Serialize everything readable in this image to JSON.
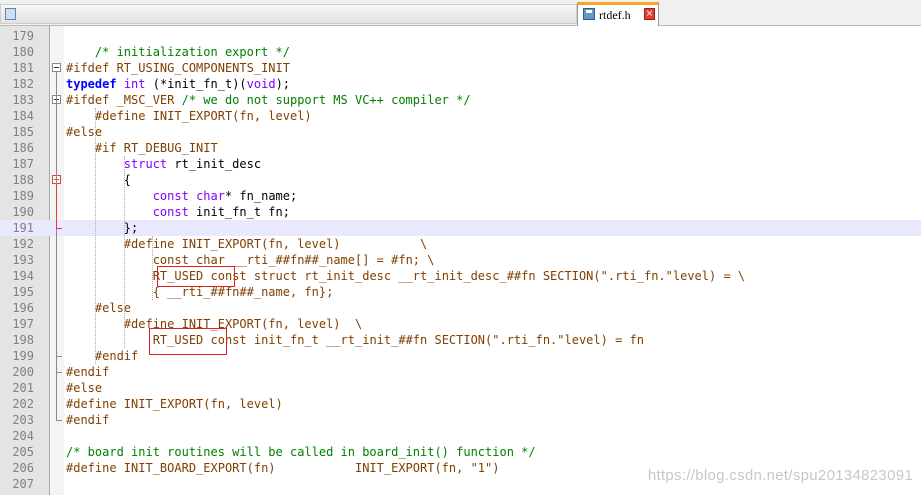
{
  "tab": {
    "filename": "rtdef.h",
    "close_glyph": "×",
    "accent_color": "#f5a623"
  },
  "lines": [
    {
      "num": "179",
      "tokens": []
    },
    {
      "num": "180",
      "tokens": [
        {
          "t": "    ",
          "c": ""
        },
        {
          "t": "/* initialization export */",
          "c": "cm"
        }
      ]
    },
    {
      "num": "181",
      "tokens": [
        {
          "t": "#ifdef RT_USING_COMPONENTS_INIT",
          "c": "pp"
        }
      ]
    },
    {
      "num": "182",
      "tokens": [
        {
          "t": "typedef",
          "c": "kw"
        },
        {
          "t": " ",
          "c": ""
        },
        {
          "t": "int",
          "c": "ty"
        },
        {
          "t": " (*init_fn_t)(",
          "c": ""
        },
        {
          "t": "void",
          "c": "ty"
        },
        {
          "t": ");",
          "c": ""
        }
      ]
    },
    {
      "num": "183",
      "tokens": [
        {
          "t": "#ifdef _MSC_VER ",
          "c": "pp"
        },
        {
          "t": "/* we do not support MS VC++ compiler */",
          "c": "cm"
        }
      ]
    },
    {
      "num": "184",
      "tokens": [
        {
          "t": "    ",
          "c": ""
        },
        {
          "t": "#define INIT_EXPORT(fn, level)",
          "c": "pp"
        }
      ]
    },
    {
      "num": "185",
      "tokens": [
        {
          "t": "#else",
          "c": "pp"
        }
      ]
    },
    {
      "num": "186",
      "tokens": [
        {
          "t": "    ",
          "c": ""
        },
        {
          "t": "#if RT_DEBUG_INIT",
          "c": "pp"
        }
      ]
    },
    {
      "num": "187",
      "tokens": [
        {
          "t": "        ",
          "c": ""
        },
        {
          "t": "struct",
          "c": "ty"
        },
        {
          "t": " rt_init_desc",
          "c": ""
        }
      ]
    },
    {
      "num": "188",
      "tokens": [
        {
          "t": "        {",
          "c": ""
        }
      ]
    },
    {
      "num": "189",
      "tokens": [
        {
          "t": "            ",
          "c": ""
        },
        {
          "t": "const",
          "c": "ty"
        },
        {
          "t": " ",
          "c": ""
        },
        {
          "t": "char",
          "c": "ty"
        },
        {
          "t": "* fn_name;",
          "c": ""
        }
      ]
    },
    {
      "num": "190",
      "tokens": [
        {
          "t": "            ",
          "c": ""
        },
        {
          "t": "const",
          "c": "ty"
        },
        {
          "t": " init_fn_t fn;",
          "c": ""
        }
      ]
    },
    {
      "num": "191",
      "tokens": [
        {
          "t": "        };",
          "c": ""
        }
      ]
    },
    {
      "num": "192",
      "tokens": [
        {
          "t": "        ",
          "c": ""
        },
        {
          "t": "#define INIT_EXPORT(fn, level)           \\",
          "c": "pp"
        }
      ]
    },
    {
      "num": "193",
      "tokens": [
        {
          "t": "            ",
          "c": ""
        },
        {
          "t": "const char __rti_##fn##_name[] = #fn; \\",
          "c": "pp"
        }
      ]
    },
    {
      "num": "194",
      "tokens": [
        {
          "t": "            ",
          "c": ""
        },
        {
          "t": "RT_USED const struct rt_init_desc __rt_init_desc_##fn SECTION(\".rti_fn.\"level) = \\",
          "c": "pp"
        }
      ]
    },
    {
      "num": "195",
      "tokens": [
        {
          "t": "            ",
          "c": ""
        },
        {
          "t": "{ __rti_##fn##_name, fn};",
          "c": "pp"
        }
      ]
    },
    {
      "num": "196",
      "tokens": [
        {
          "t": "    ",
          "c": ""
        },
        {
          "t": "#else",
          "c": "pp"
        }
      ]
    },
    {
      "num": "197",
      "tokens": [
        {
          "t": "        ",
          "c": ""
        },
        {
          "t": "#define INIT_EXPORT(fn, level)  \\",
          "c": "pp"
        }
      ]
    },
    {
      "num": "198",
      "tokens": [
        {
          "t": "            ",
          "c": ""
        },
        {
          "t": "RT_USED const init_fn_t __rt_init_##fn SECTION(\".rti_fn.\"level) = fn",
          "c": "pp"
        }
      ]
    },
    {
      "num": "199",
      "tokens": [
        {
          "t": "    ",
          "c": ""
        },
        {
          "t": "#endif",
          "c": "pp"
        }
      ]
    },
    {
      "num": "200",
      "tokens": [
        {
          "t": "#endif",
          "c": "pp"
        }
      ]
    },
    {
      "num": "201",
      "tokens": [
        {
          "t": "#else",
          "c": "pp"
        }
      ]
    },
    {
      "num": "202",
      "tokens": [
        {
          "t": "#define INIT_EXPORT(fn, level)",
          "c": "pp"
        }
      ]
    },
    {
      "num": "203",
      "tokens": [
        {
          "t": "#endif",
          "c": "pp"
        }
      ]
    },
    {
      "num": "204",
      "tokens": []
    },
    {
      "num": "205",
      "tokens": [
        {
          "t": "/* board init routines will be called in board_init() function */",
          "c": "cm"
        }
      ]
    },
    {
      "num": "206",
      "tokens": [
        {
          "t": "#define INIT_BOARD_EXPORT(fn)           INIT_EXPORT(fn, \"1\")",
          "c": "pp"
        }
      ]
    },
    {
      "num": "207",
      "tokens": []
    }
  ],
  "current_line": "191",
  "watermark": "https://blog.csdn.net/spu20134823091"
}
